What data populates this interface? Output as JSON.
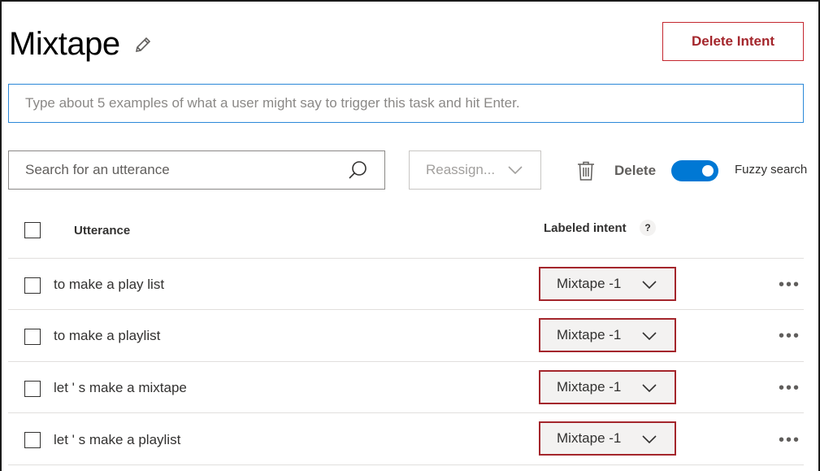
{
  "header": {
    "title": "Mixtape",
    "delete_intent_label": "Delete Intent"
  },
  "utterance_entry": {
    "placeholder": "Type about 5 examples of what a user might say to trigger this task and hit Enter."
  },
  "toolbar": {
    "search_placeholder": "Search for an utterance",
    "reassign_label": "Reassign...",
    "delete_label": "Delete",
    "fuzzy_search_label": "Fuzzy search",
    "fuzzy_search_on": true
  },
  "table": {
    "columns": {
      "utterance": "Utterance",
      "labeled_intent": "Labeled intent",
      "help_glyph": "?"
    },
    "rows": [
      {
        "utterance": "to make a play list",
        "intent": "Mixtape -1"
      },
      {
        "utterance": "to make a playlist",
        "intent": "Mixtape -1"
      },
      {
        "utterance": "let ' s make a mixtape",
        "intent": "Mixtape -1"
      },
      {
        "utterance": "let ' s make a playlist",
        "intent": "Mixtape -1"
      }
    ],
    "more_glyph": "•••"
  },
  "colors": {
    "accent": "#0078d4",
    "danger": "#a4262c"
  },
  "icons": [
    "edit-icon",
    "search-icon",
    "chevron-down-icon",
    "trash-icon",
    "more-icon"
  ]
}
